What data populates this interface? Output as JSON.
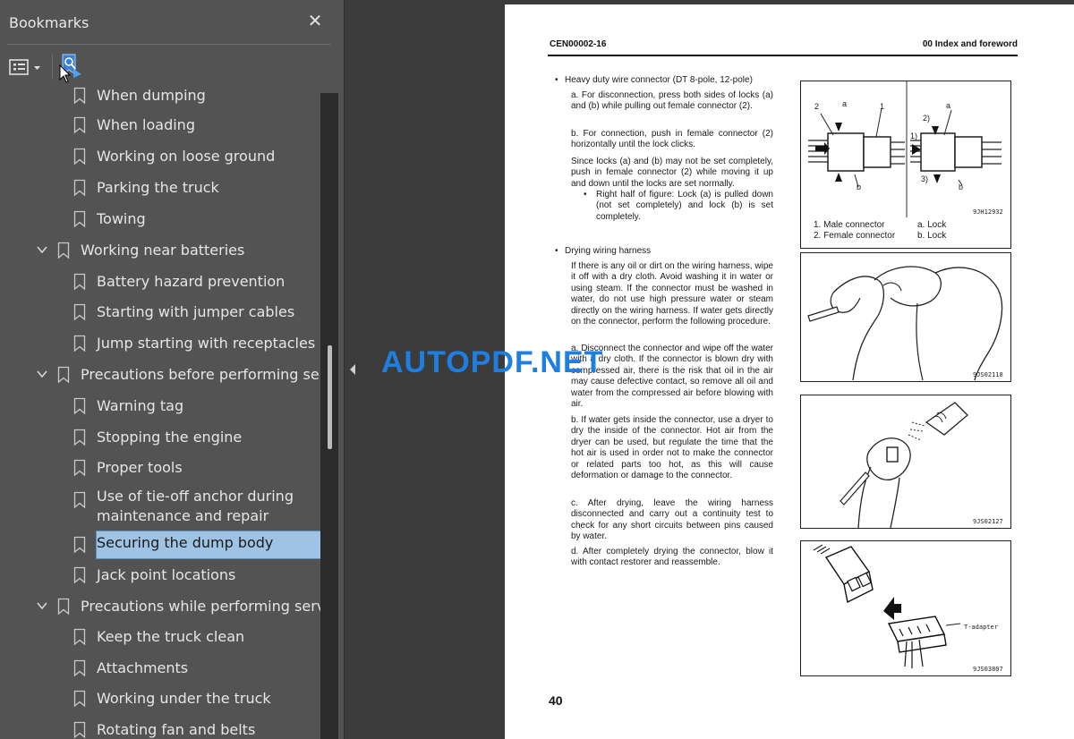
{
  "bookmarks_panel": {
    "title": "Bookmarks",
    "close_icon": "close-icon",
    "options_icon": "bookmark-options-icon",
    "find_icon": "find-current-bookmark-icon",
    "items": [
      {
        "level": 2,
        "label": "When dumping",
        "expanded": null
      },
      {
        "level": 2,
        "label": "When loading",
        "expanded": null
      },
      {
        "level": 2,
        "label": "Working on loose ground",
        "expanded": null
      },
      {
        "level": 2,
        "label": "Parking the truck",
        "expanded": null
      },
      {
        "level": 2,
        "label": "Towing",
        "expanded": null
      },
      {
        "level": 1,
        "label": "Working near batteries",
        "expanded": true
      },
      {
        "level": 2,
        "label": "Battery hazard prevention",
        "expanded": null
      },
      {
        "level": 2,
        "label": "Starting with jumper cables",
        "expanded": null
      },
      {
        "level": 2,
        "label": "Jump starting with receptacles",
        "expanded": null
      },
      {
        "level": 1,
        "label": "Precautions before performing service",
        "expanded": true
      },
      {
        "level": 2,
        "label": "Warning tag",
        "expanded": null
      },
      {
        "level": 2,
        "label": "Stopping the engine",
        "expanded": null
      },
      {
        "level": 2,
        "label": "Proper tools",
        "expanded": null
      },
      {
        "level": 2,
        "label": "Use of tie-off anchor during maintenance and repair",
        "expanded": null
      },
      {
        "level": 2,
        "label": "Securing the dump body",
        "expanded": null,
        "selected": true
      },
      {
        "level": 2,
        "label": "Jack point locations",
        "expanded": null
      },
      {
        "level": 1,
        "label": "Precautions while performing service",
        "expanded": true
      },
      {
        "level": 2,
        "label": "Keep the truck clean",
        "expanded": null
      },
      {
        "level": 2,
        "label": "Attachments",
        "expanded": null
      },
      {
        "level": 2,
        "label": "Working under the truck",
        "expanded": null
      },
      {
        "level": 2,
        "label": "Rotating fan and belts",
        "expanded": null
      }
    ]
  },
  "page": {
    "doc_code": "CEN00002-16",
    "section": "00 Index and foreword",
    "page_number": "40",
    "connector_heading": "Heavy duty wire connector (DT 8-pole, 12-pole)",
    "connector_a": "a. For disconnection, press both sides of locks (a) and (b) while pulling out female connector (2).",
    "connector_b": "b. For connection, push in female connector (2) horizontally until the lock clicks.",
    "connector_note": "Since locks (a) and (b) may not be set completely, push in female connector (2) while moving it up and down until the locks are set normally.",
    "connector_note_sub": "Right half of figure: Lock (a) is pulled down (not set completely) and lock (b) is set completely.",
    "drying_heading": "Drying wiring harness",
    "drying_intro": "If there is any oil or dirt on the wiring harness, wipe it off with a dry cloth. Avoid washing it in water or using steam. If the connector must be washed in water, do not use high pressure water or steam directly on the wiring harness. If water gets directly on the connector, perform the following procedure.",
    "drying_a": "a. Disconnect the connector and wipe off the water with a dry cloth. If the connector is blown dry with compressed air, there is the risk that oil in the air may cause defective contact, so remove all oil and water from the compressed air before blowing with air.",
    "drying_b": "b. If water gets inside the connector, use a dryer to dry the inside of the connector. Hot air from the dryer can be used, but regulate the time that the hot air is used in order not to make the connector or related parts too hot, as this will cause deformation or damage to the connector.",
    "drying_c": "c. After drying, leave the wiring harness disconnected and carry out a continuity test to check for any short circuits between pins caused by water.",
    "drying_d": "d. After completely drying the connector, blow it with contact restorer and reassemble.",
    "fig1": {
      "code": "9JH12932",
      "cap1": "1. Male connector",
      "cap2": "2. Female connector",
      "cap3": "a. Lock",
      "cap4": "b. Lock",
      "labels": [
        "2",
        "a",
        "1",
        "b",
        "2)",
        "a",
        "1)",
        "3)",
        "b"
      ]
    },
    "fig2": {
      "code": "9JS02118"
    },
    "fig3": {
      "code": "9JS02127"
    },
    "fig4": {
      "code": "9JS03807",
      "label": "T-adapter"
    }
  },
  "watermark": "AUTOPDF.NET",
  "colors": {
    "panel_bg": "#535353",
    "viewer_bg": "#3b3b3b",
    "selection": "#9fc3e4",
    "watermark": "#1e7fe0"
  }
}
